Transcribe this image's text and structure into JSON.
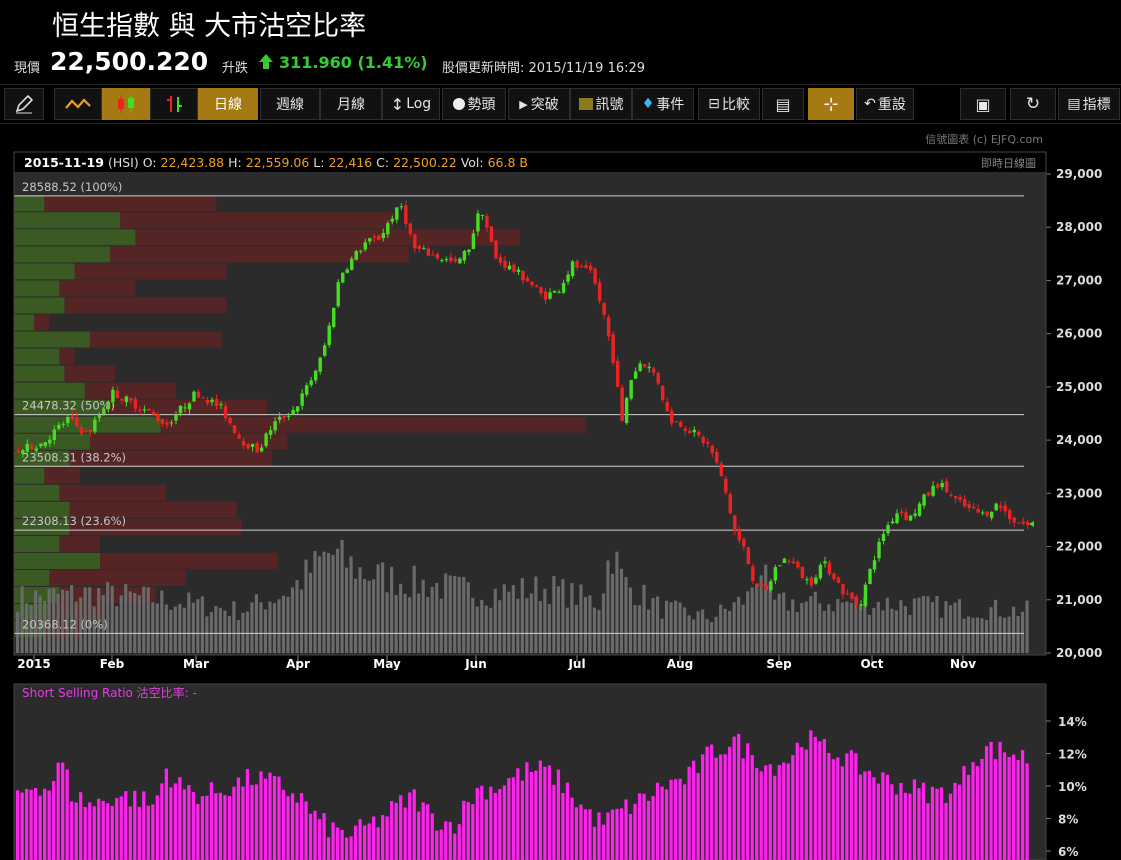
{
  "header": {
    "title": "恒生指數 與 大市沽空比率"
  },
  "quote": {
    "label": "現價",
    "price": "22,500.220",
    "change_label": "升跌",
    "change": "311.960 (1.41%)",
    "update_label": "股價更新時間: 2015/11/19 16:29"
  },
  "toolbar": {
    "daily": "日線",
    "weekly": "週線",
    "monthly": "月線",
    "log": "Log",
    "trend": "勢頭",
    "breakout": "突破",
    "signal": "訊號",
    "event": "事件",
    "compare": "比較",
    "reset": "重設",
    "indicator": "指標"
  },
  "credit": "信號圖表 (c) EJFQ.com",
  "chart_info": {
    "date": "2015-11-19",
    "symbol": "(HSI)",
    "o_label": "O:",
    "o": "22,423.88",
    "h_label": "H:",
    "h": "22,559.06",
    "l_label": "L:",
    "l": "22,416",
    "c_label": "C:",
    "c": "22,500.22",
    "vol_label": "Vol:",
    "vol": "66.8 B",
    "type_label": "即時日線圖"
  },
  "colors": {
    "up": "#44dd22",
    "down": "#ee2222",
    "volume": "#6a6a6a",
    "short": "#ff22ee",
    "accent": "#f0a020",
    "gain": "#33cc33"
  },
  "chart_data": [
    {
      "type": "candlestick",
      "y_axis_ticks": [
        "29,000",
        "28,000",
        "27,000",
        "26,000",
        "25,000",
        "24,000",
        "23,000",
        "22,000",
        "21,000",
        "20,000"
      ],
      "ylim": [
        20000,
        29000
      ],
      "x_month_labels": [
        "2015",
        "Feb",
        "Mar",
        "Apr",
        "May",
        "Jun",
        "Jul",
        "Aug",
        "Sep",
        "Oct",
        "Nov"
      ],
      "fib_levels": [
        {
          "label": "28588.52 (100%)",
          "value": 28588.52
        },
        {
          "label": "24478.32 (50%)",
          "value": 24478.32
        },
        {
          "label": "23508.31 (38.2%)",
          "value": 23508.31
        },
        {
          "label": "22308.13 (23.6%)",
          "value": 22308.13
        },
        {
          "label": "20368.12 (0%)",
          "value": 20368.12
        }
      ],
      "close_path": [
        [
          0,
          23800
        ],
        [
          10,
          23950
        ],
        [
          20,
          24400
        ],
        [
          28,
          24100
        ],
        [
          38,
          24900
        ],
        [
          50,
          24600
        ],
        [
          60,
          24300
        ],
        [
          72,
          24900
        ],
        [
          82,
          24600
        ],
        [
          90,
          24000
        ],
        [
          97,
          23800
        ],
        [
          103,
          24300
        ],
        [
          112,
          24600
        ],
        [
          118,
          25100
        ],
        [
          123,
          25600
        ],
        [
          126,
          26200
        ],
        [
          130,
          27100
        ],
        [
          135,
          27400
        ],
        [
          140,
          27700
        ],
        [
          146,
          27800
        ],
        [
          151,
          28200
        ],
        [
          155,
          28400
        ],
        [
          160,
          27600
        ],
        [
          166,
          27500
        ],
        [
          172,
          27400
        ],
        [
          177,
          27300
        ],
        [
          182,
          27600
        ],
        [
          187,
          28400
        ],
        [
          193,
          27400
        ],
        [
          200,
          27200
        ],
        [
          206,
          27000
        ],
        [
          212,
          26700
        ],
        [
          218,
          26800
        ],
        [
          224,
          27300
        ],
        [
          232,
          27100
        ],
        [
          237,
          26300
        ],
        [
          241,
          25400
        ],
        [
          244,
          24300
        ],
        [
          247,
          25100
        ],
        [
          252,
          25500
        ],
        [
          258,
          25200
        ],
        [
          263,
          24400
        ],
        [
          268,
          24300
        ],
        [
          274,
          24100
        ],
        [
          279,
          23900
        ],
        [
          282,
          23600
        ],
        [
          286,
          23000
        ],
        [
          290,
          22200
        ],
        [
          293,
          22000
        ],
        [
          297,
          21400
        ],
        [
          302,
          21100
        ],
        [
          306,
          21600
        ],
        [
          311,
          21800
        ],
        [
          316,
          21500
        ],
        [
          320,
          21300
        ],
        [
          325,
          21700
        ],
        [
          329,
          21500
        ],
        [
          334,
          21100
        ],
        [
          340,
          20900
        ],
        [
          346,
          21800
        ],
        [
          350,
          22300
        ],
        [
          356,
          22700
        ],
        [
          360,
          22500
        ],
        [
          366,
          22900
        ],
        [
          372,
          23200
        ],
        [
          378,
          22900
        ],
        [
          384,
          22700
        ],
        [
          390,
          22600
        ],
        [
          396,
          22800
        ],
        [
          402,
          22500
        ],
        [
          408,
          22400
        ]
      ],
      "volume_path": [
        [
          0,
          5.5
        ],
        [
          30,
          6.0
        ],
        [
          60,
          5.3
        ],
        [
          90,
          4.2
        ],
        [
          110,
          6.2
        ],
        [
          126,
          10.0
        ],
        [
          140,
          8.0
        ],
        [
          160,
          7.0
        ],
        [
          190,
          6.0
        ],
        [
          215,
          6.5
        ],
        [
          235,
          5.0
        ],
        [
          240,
          10.5
        ],
        [
          245,
          7.0
        ],
        [
          260,
          4.5
        ],
        [
          280,
          3.5
        ],
        [
          295,
          5.5
        ],
        [
          300,
          9.0
        ],
        [
          305,
          5.0
        ],
        [
          330,
          5.0
        ],
        [
          350,
          5.0
        ],
        [
          380,
          4.5
        ],
        [
          408,
          4.2
        ]
      ],
      "volume_unit": "HK$ bn (relative)",
      "volume_profile": [
        {
          "price": 28450,
          "up": 6,
          "down": 34
        },
        {
          "price": 28130,
          "up": 21,
          "down": 54
        },
        {
          "price": 27810,
          "up": 24,
          "down": 76
        },
        {
          "price": 27490,
          "up": 19,
          "down": 59
        },
        {
          "price": 27170,
          "up": 12,
          "down": 30
        },
        {
          "price": 26850,
          "up": 9,
          "down": 15
        },
        {
          "price": 26530,
          "up": 10,
          "down": 32
        },
        {
          "price": 26210,
          "up": 4,
          "down": 3
        },
        {
          "price": 25890,
          "up": 15,
          "down": 26
        },
        {
          "price": 25570,
          "up": 9,
          "down": 3
        },
        {
          "price": 25250,
          "up": 10,
          "down": 10
        },
        {
          "price": 24930,
          "up": 14,
          "down": 18
        },
        {
          "price": 24610,
          "up": 18,
          "down": 32
        },
        {
          "price": 24290,
          "up": 29,
          "down": 84
        },
        {
          "price": 23970,
          "up": 15,
          "down": 39
        },
        {
          "price": 23650,
          "up": 11,
          "down": 40
        },
        {
          "price": 23330,
          "up": 6,
          "down": 7
        },
        {
          "price": 23010,
          "up": 9,
          "down": 21
        },
        {
          "price": 22690,
          "up": 11,
          "down": 33
        },
        {
          "price": 22370,
          "up": 11,
          "down": 34
        },
        {
          "price": 22050,
          "up": 9,
          "down": 8
        },
        {
          "price": 21730,
          "up": 17,
          "down": 35
        },
        {
          "price": 21410,
          "up": 7,
          "down": 27
        },
        {
          "price": 21090,
          "up": 9,
          "down": 19
        },
        {
          "price": 20770,
          "up": 7,
          "down": 11
        },
        {
          "price": 20450,
          "up": 6,
          "down": 7
        }
      ]
    },
    {
      "type": "bar",
      "title": "Short Selling Ratio 沽空比率: -",
      "y_axis_ticks": [
        "14%",
        "12%",
        "10%",
        "8%",
        "6%"
      ],
      "ylim": [
        6,
        14
      ],
      "values_path": [
        [
          0,
          9.5
        ],
        [
          8,
          10.2
        ],
        [
          12,
          9.7
        ],
        [
          18,
          11.5
        ],
        [
          22,
          9.5
        ],
        [
          30,
          8.8
        ],
        [
          40,
          9.4
        ],
        [
          50,
          9.2
        ],
        [
          55,
          8.7
        ],
        [
          60,
          11.0
        ],
        [
          65,
          10.0
        ],
        [
          75,
          9.4
        ],
        [
          85,
          9.9
        ],
        [
          95,
          10.5
        ],
        [
          105,
          10.1
        ],
        [
          115,
          9.2
        ],
        [
          120,
          8.1
        ],
        [
          127,
          7.3
        ],
        [
          135,
          7.0
        ],
        [
          145,
          7.8
        ],
        [
          152,
          8.6
        ],
        [
          160,
          9.4
        ],
        [
          168,
          8.0
        ],
        [
          176,
          7.6
        ],
        [
          180,
          8.5
        ],
        [
          186,
          9.8
        ],
        [
          193,
          9.9
        ],
        [
          200,
          10.5
        ],
        [
          206,
          10.9
        ],
        [
          213,
          11.0
        ],
        [
          220,
          10.2
        ],
        [
          228,
          8.7
        ],
        [
          236,
          7.7
        ],
        [
          244,
          8.5
        ],
        [
          252,
          9.1
        ],
        [
          262,
          10.1
        ],
        [
          270,
          10.4
        ],
        [
          280,
          12.0
        ],
        [
          290,
          12.8
        ],
        [
          296,
          12.0
        ],
        [
          304,
          11.2
        ],
        [
          312,
          11.7
        ],
        [
          318,
          13.0
        ],
        [
          326,
          12.3
        ],
        [
          334,
          11.8
        ],
        [
          342,
          11.0
        ],
        [
          350,
          10.4
        ],
        [
          360,
          9.9
        ],
        [
          368,
          9.6
        ],
        [
          374,
          9.6
        ],
        [
          380,
          9.9
        ],
        [
          386,
          11.7
        ],
        [
          392,
          12.3
        ],
        [
          400,
          12.1
        ],
        [
          408,
          11.7
        ]
      ]
    }
  ]
}
